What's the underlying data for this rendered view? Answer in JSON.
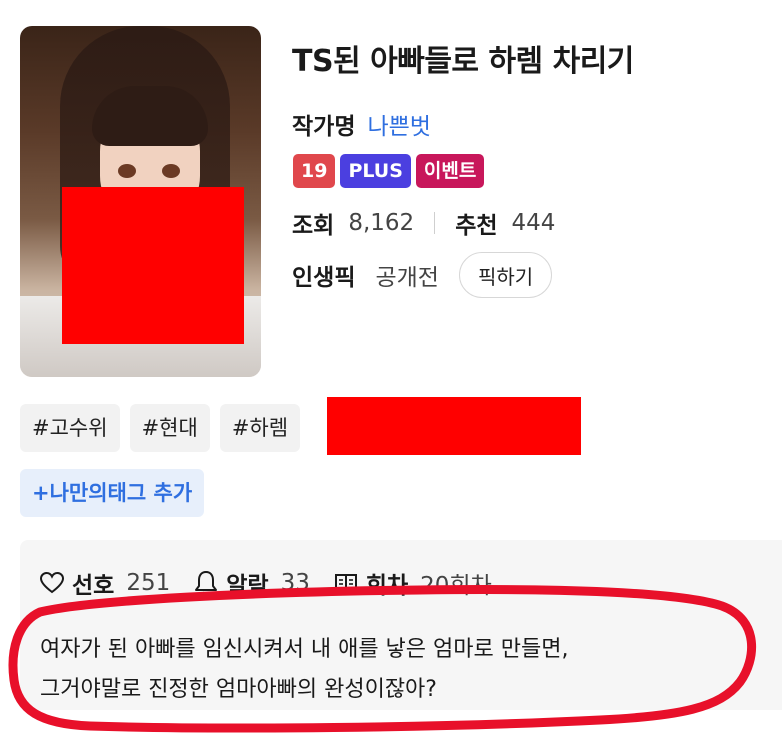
{
  "work": {
    "title": "TS된 아빠들로 하렘 차리기",
    "author_label": "작가명",
    "author_name": "나쁜벗",
    "badges": [
      "19",
      "PLUS",
      "이벤트"
    ],
    "views_label": "조회",
    "views_value": "8,162",
    "recommend_label": "추천",
    "recommend_value": "444",
    "pick_label": "인생픽",
    "pick_value": "공개전",
    "pick_button": "픽하기"
  },
  "tags": [
    "#고수위",
    "#현대",
    "#하렘"
  ],
  "add_tag_label": "+나만의태그 추가",
  "info": {
    "likes_label": "선호",
    "likes_value": "251",
    "alarm_label": "알람",
    "alarm_value": "33",
    "episodes_label": "회차",
    "episodes_value": "20회차"
  },
  "synopsis": [
    "여자가 된 아빠를 임신시켜서 내 애를 낳은 엄마로 만들면,",
    "그거야말로 진정한 엄마아빠의 완성이잖아?"
  ],
  "colors": {
    "accent_blue": "#2f6fe0",
    "badge_age": "#e0474c",
    "badge_plus": "#4b3fe0",
    "badge_event": "#c8175b",
    "censor": "#ff0000",
    "annotation": "#e8102a"
  },
  "icons": [
    "heart-icon",
    "bell-icon",
    "episodes-icon"
  ]
}
